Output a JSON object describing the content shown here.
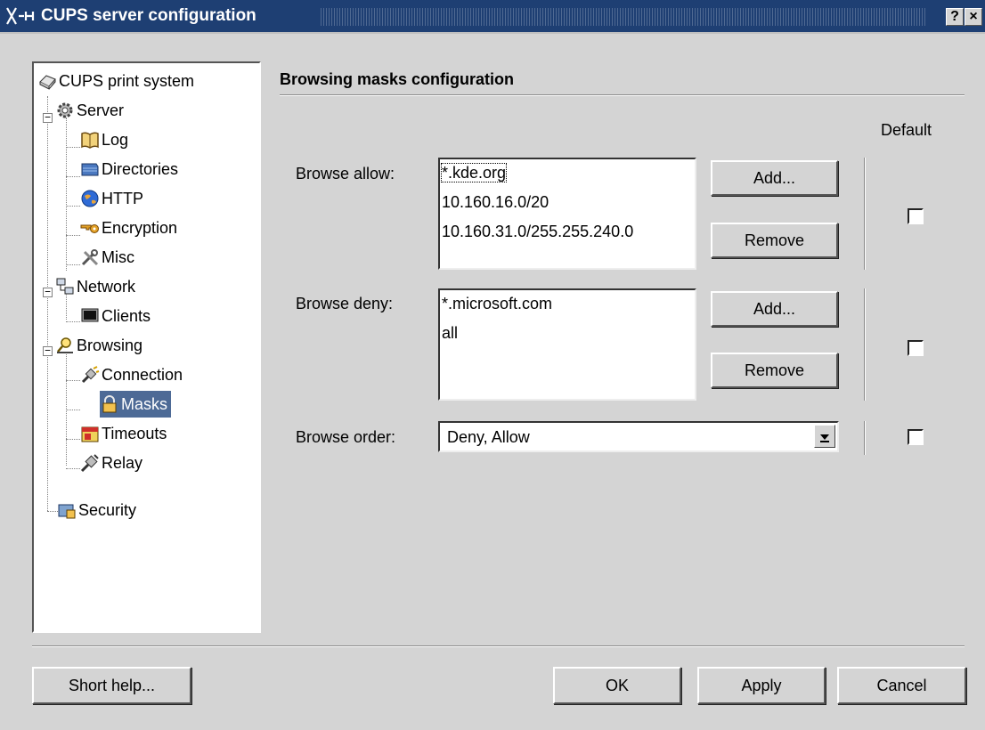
{
  "window": {
    "title": "CUPS server configuration",
    "help_btn": "?",
    "close_btn": "×"
  },
  "tree": {
    "items": [
      {
        "label": "CUPS print system",
        "icon": "printer-icon"
      },
      {
        "label": "Server",
        "icon": "gear-icon"
      },
      {
        "label": "Log",
        "icon": "book-icon"
      },
      {
        "label": "Directories",
        "icon": "folder-stack-icon"
      },
      {
        "label": "HTTP",
        "icon": "globe-icon"
      },
      {
        "label": "Encryption",
        "icon": "key-icon"
      },
      {
        "label": "Misc",
        "icon": "tools-icon"
      },
      {
        "label": "Network",
        "icon": "network-icon"
      },
      {
        "label": "Clients",
        "icon": "monitor-icon"
      },
      {
        "label": "Browsing",
        "icon": "browse-icon"
      },
      {
        "label": "Connection",
        "icon": "plug-icon"
      },
      {
        "label": "Masks",
        "icon": "lock-icon"
      },
      {
        "label": "Timeouts",
        "icon": "timer-icon"
      },
      {
        "label": "Relay",
        "icon": "relay-icon"
      },
      {
        "label": "Security",
        "icon": "security-icon"
      }
    ],
    "selected": "Masks"
  },
  "section": {
    "title": "Browsing masks configuration",
    "default_header": "Default"
  },
  "browse_allow": {
    "label": "Browse allow:",
    "items": [
      "*.kde.org",
      "10.160.16.0/20",
      "10.160.31.0/255.255.240.0"
    ],
    "add": "Add...",
    "remove": "Remove",
    "default_checked": false
  },
  "browse_deny": {
    "label": "Browse deny:",
    "items": [
      "*.microsoft.com",
      "all"
    ],
    "add": "Add...",
    "remove": "Remove",
    "default_checked": false
  },
  "browse_order": {
    "label": "Browse order:",
    "value": "Deny, Allow",
    "default_checked": false
  },
  "footer": {
    "short_help": "Short help...",
    "ok": "OK",
    "apply": "Apply",
    "cancel": "Cancel"
  }
}
